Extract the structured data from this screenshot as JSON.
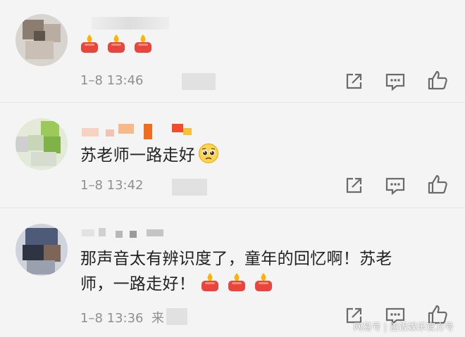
{
  "comments": [
    {
      "text": "",
      "reactions": "candle ×3",
      "time": "1–8 13:46",
      "actions": [
        "share-icon",
        "comment-icon",
        "like-icon"
      ]
    },
    {
      "text": "苏老师一路走好",
      "reactions": "pleading-face",
      "time": "1–8 13:42",
      "actions": [
        "share-icon",
        "comment-icon",
        "like-icon"
      ]
    },
    {
      "text_line1": "那声音太有辨识度了，童年的回忆啊！苏老",
      "text_line2": "师，一路走好！",
      "reactions": "candle ×3",
      "time": "1–8 13:36",
      "source": "来",
      "actions": [
        "share-icon",
        "comment-icon",
        "like-icon"
      ]
    }
  ],
  "watermark": {
    "left": "网易号",
    "separator": "|",
    "right": "盖饭娱乐官方号"
  },
  "colors": {
    "background": "#f4f4f4",
    "text": "#222222",
    "meta": "#8f8f8f",
    "icon": "#6b6b6b",
    "candle": "#e8463c",
    "flame": "#ffb300"
  }
}
